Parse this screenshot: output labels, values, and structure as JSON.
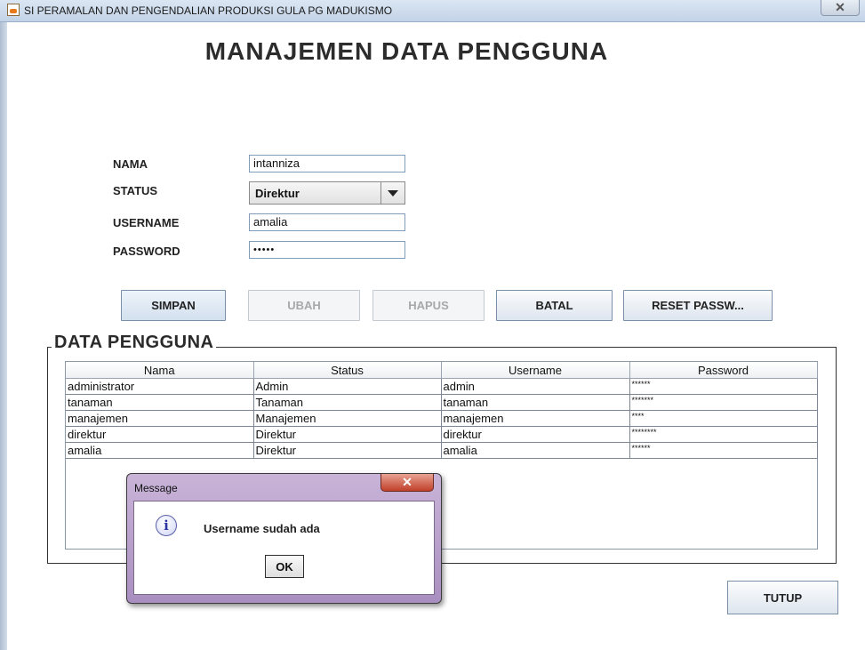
{
  "window": {
    "title": "SI PERAMALAN DAN PENGENDALIAN PRODUKSI GULA PG MADUKISMO",
    "close_glyph": "✕"
  },
  "heading": "MANAJEMEN DATA PENGGUNA",
  "form": {
    "nama_label": "NAMA",
    "nama_value": "intanniza",
    "status_label": "STATUS",
    "status_value": "Direktur",
    "username_label": "USERNAME",
    "username_value": "amalia",
    "password_label": "PASSWORD",
    "password_value": "•••••"
  },
  "buttons": {
    "simpan": "SIMPAN",
    "ubah": "UBAH",
    "hapus": "HAPUS",
    "batal": "BATAL",
    "reset": "RESET PASSW...",
    "tutup": "TUTUP"
  },
  "group_title": "DATA PENGGUNA",
  "table": {
    "headers": [
      "Nama",
      "Status",
      "Username",
      "Password"
    ],
    "rows": [
      [
        "administrator",
        "Admin",
        "admin",
        "******"
      ],
      [
        "tanaman",
        "Tanaman",
        "tanaman",
        "*******"
      ],
      [
        "manajemen",
        "Manajemen",
        "manajemen",
        "****"
      ],
      [
        "direktur",
        "Direktur",
        "direktur",
        "********"
      ],
      [
        "amalia",
        "Direktur",
        "amalia",
        "******"
      ]
    ]
  },
  "dialog": {
    "title": "Message",
    "message": "Username sudah ada",
    "ok": "OK",
    "icon_glyph": "i",
    "close_glyph": "✕"
  }
}
